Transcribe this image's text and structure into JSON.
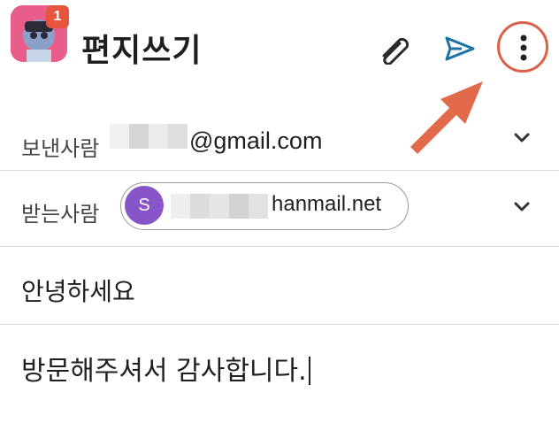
{
  "header": {
    "title": "편지쓰기",
    "notification_count": "1",
    "icons": [
      "attach-icon",
      "send-icon",
      "more-vert-icon"
    ],
    "accent": "#1a73a8",
    "highlight_color": "#d9624a"
  },
  "from": {
    "label": "보낸사람",
    "address_suffix": "@gmail.com"
  },
  "to": {
    "label": "받는사람",
    "avatar_letter": "S",
    "avatar_color": "#8855c8",
    "address_suffix": "hanmail.net"
  },
  "subject": "안녕하세요",
  "body": "방문해주셔서 감사합니다."
}
